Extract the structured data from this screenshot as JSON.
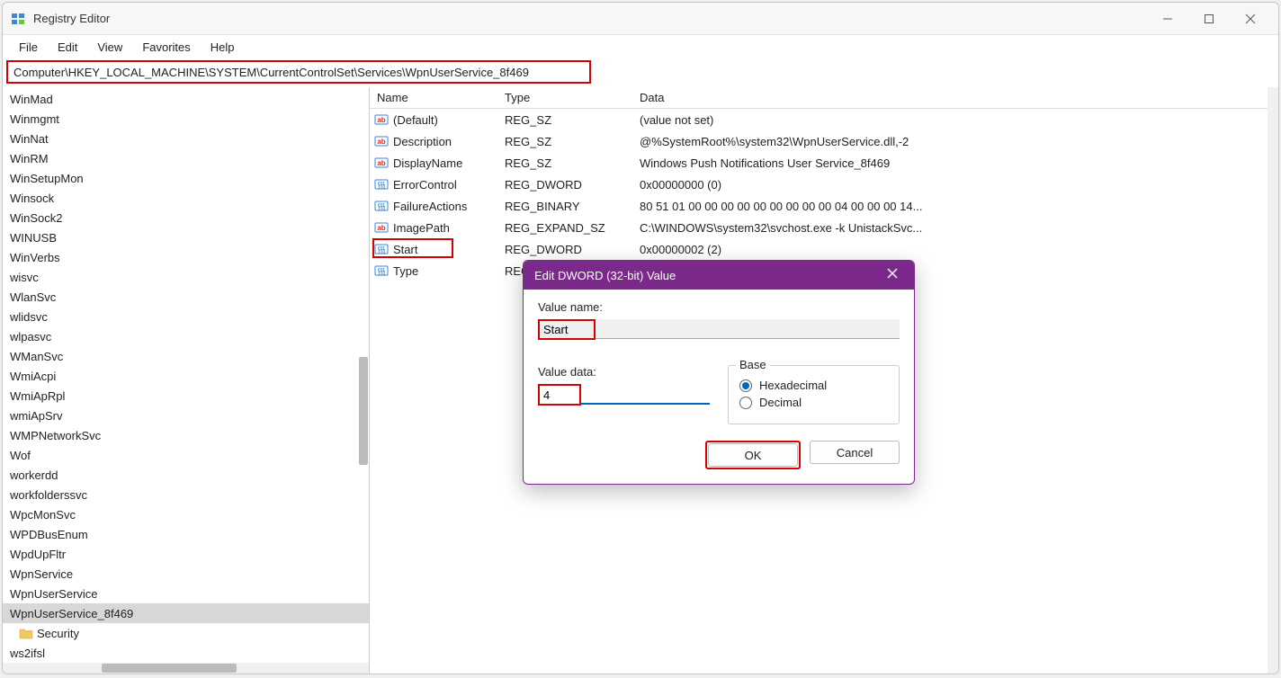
{
  "window": {
    "title": "Registry Editor"
  },
  "menu": {
    "file": "File",
    "edit": "Edit",
    "view": "View",
    "favorites": "Favorites",
    "help": "Help"
  },
  "address": "Computer\\HKEY_LOCAL_MACHINE\\SYSTEM\\CurrentControlSet\\Services\\WpnUserService_8f469",
  "tree": {
    "items": [
      "WinMad",
      "Winmgmt",
      "WinNat",
      "WinRM",
      "WinSetupMon",
      "Winsock",
      "WinSock2",
      "WINUSB",
      "WinVerbs",
      "wisvc",
      "WlanSvc",
      "wlidsvc",
      "wlpasvc",
      "WManSvc",
      "WmiAcpi",
      "WmiApRpl",
      "wmiApSrv",
      "WMPNetworkSvc",
      "Wof",
      "workerdd",
      "workfolderssvc",
      "WpcMonSvc",
      "WPDBusEnum",
      "WpdUpFltr",
      "WpnService",
      "WpnUserService",
      "WpnUserService_8f469"
    ],
    "selected": "WpnUserService_8f469",
    "folder": "Security",
    "after": [
      "ws2ifsl"
    ]
  },
  "columns": {
    "name": "Name",
    "type": "Type",
    "data": "Data"
  },
  "values": [
    {
      "icon": "ab",
      "name": "(Default)",
      "type": "REG_SZ",
      "data": "(value not set)"
    },
    {
      "icon": "ab",
      "name": "Description",
      "type": "REG_SZ",
      "data": "@%SystemRoot%\\system32\\WpnUserService.dll,-2"
    },
    {
      "icon": "ab",
      "name": "DisplayName",
      "type": "REG_SZ",
      "data": "Windows Push Notifications User Service_8f469"
    },
    {
      "icon": "bin",
      "name": "ErrorControl",
      "type": "REG_DWORD",
      "data": "0x00000000 (0)"
    },
    {
      "icon": "bin",
      "name": "FailureActions",
      "type": "REG_BINARY",
      "data": "80 51 01 00 00 00 00 00 00 00 00 00 04 00 00 00 14..."
    },
    {
      "icon": "ab",
      "name": "ImagePath",
      "type": "REG_EXPAND_SZ",
      "data": "C:\\WINDOWS\\system32\\svchost.exe -k UnistackSvc..."
    },
    {
      "icon": "bin",
      "name": "Start",
      "type": "REG_DWORD",
      "data": "0x00000002 (2)"
    },
    {
      "icon": "bin",
      "name": "Type",
      "type": "REG_",
      "data": ""
    }
  ],
  "dialog": {
    "title": "Edit DWORD (32-bit) Value",
    "value_name_label": "Value name:",
    "value_name": "Start",
    "value_data_label": "Value data:",
    "value_data": "4",
    "base_label": "Base",
    "hex": "Hexadecimal",
    "dec": "Decimal",
    "ok": "OK",
    "cancel": "Cancel"
  }
}
